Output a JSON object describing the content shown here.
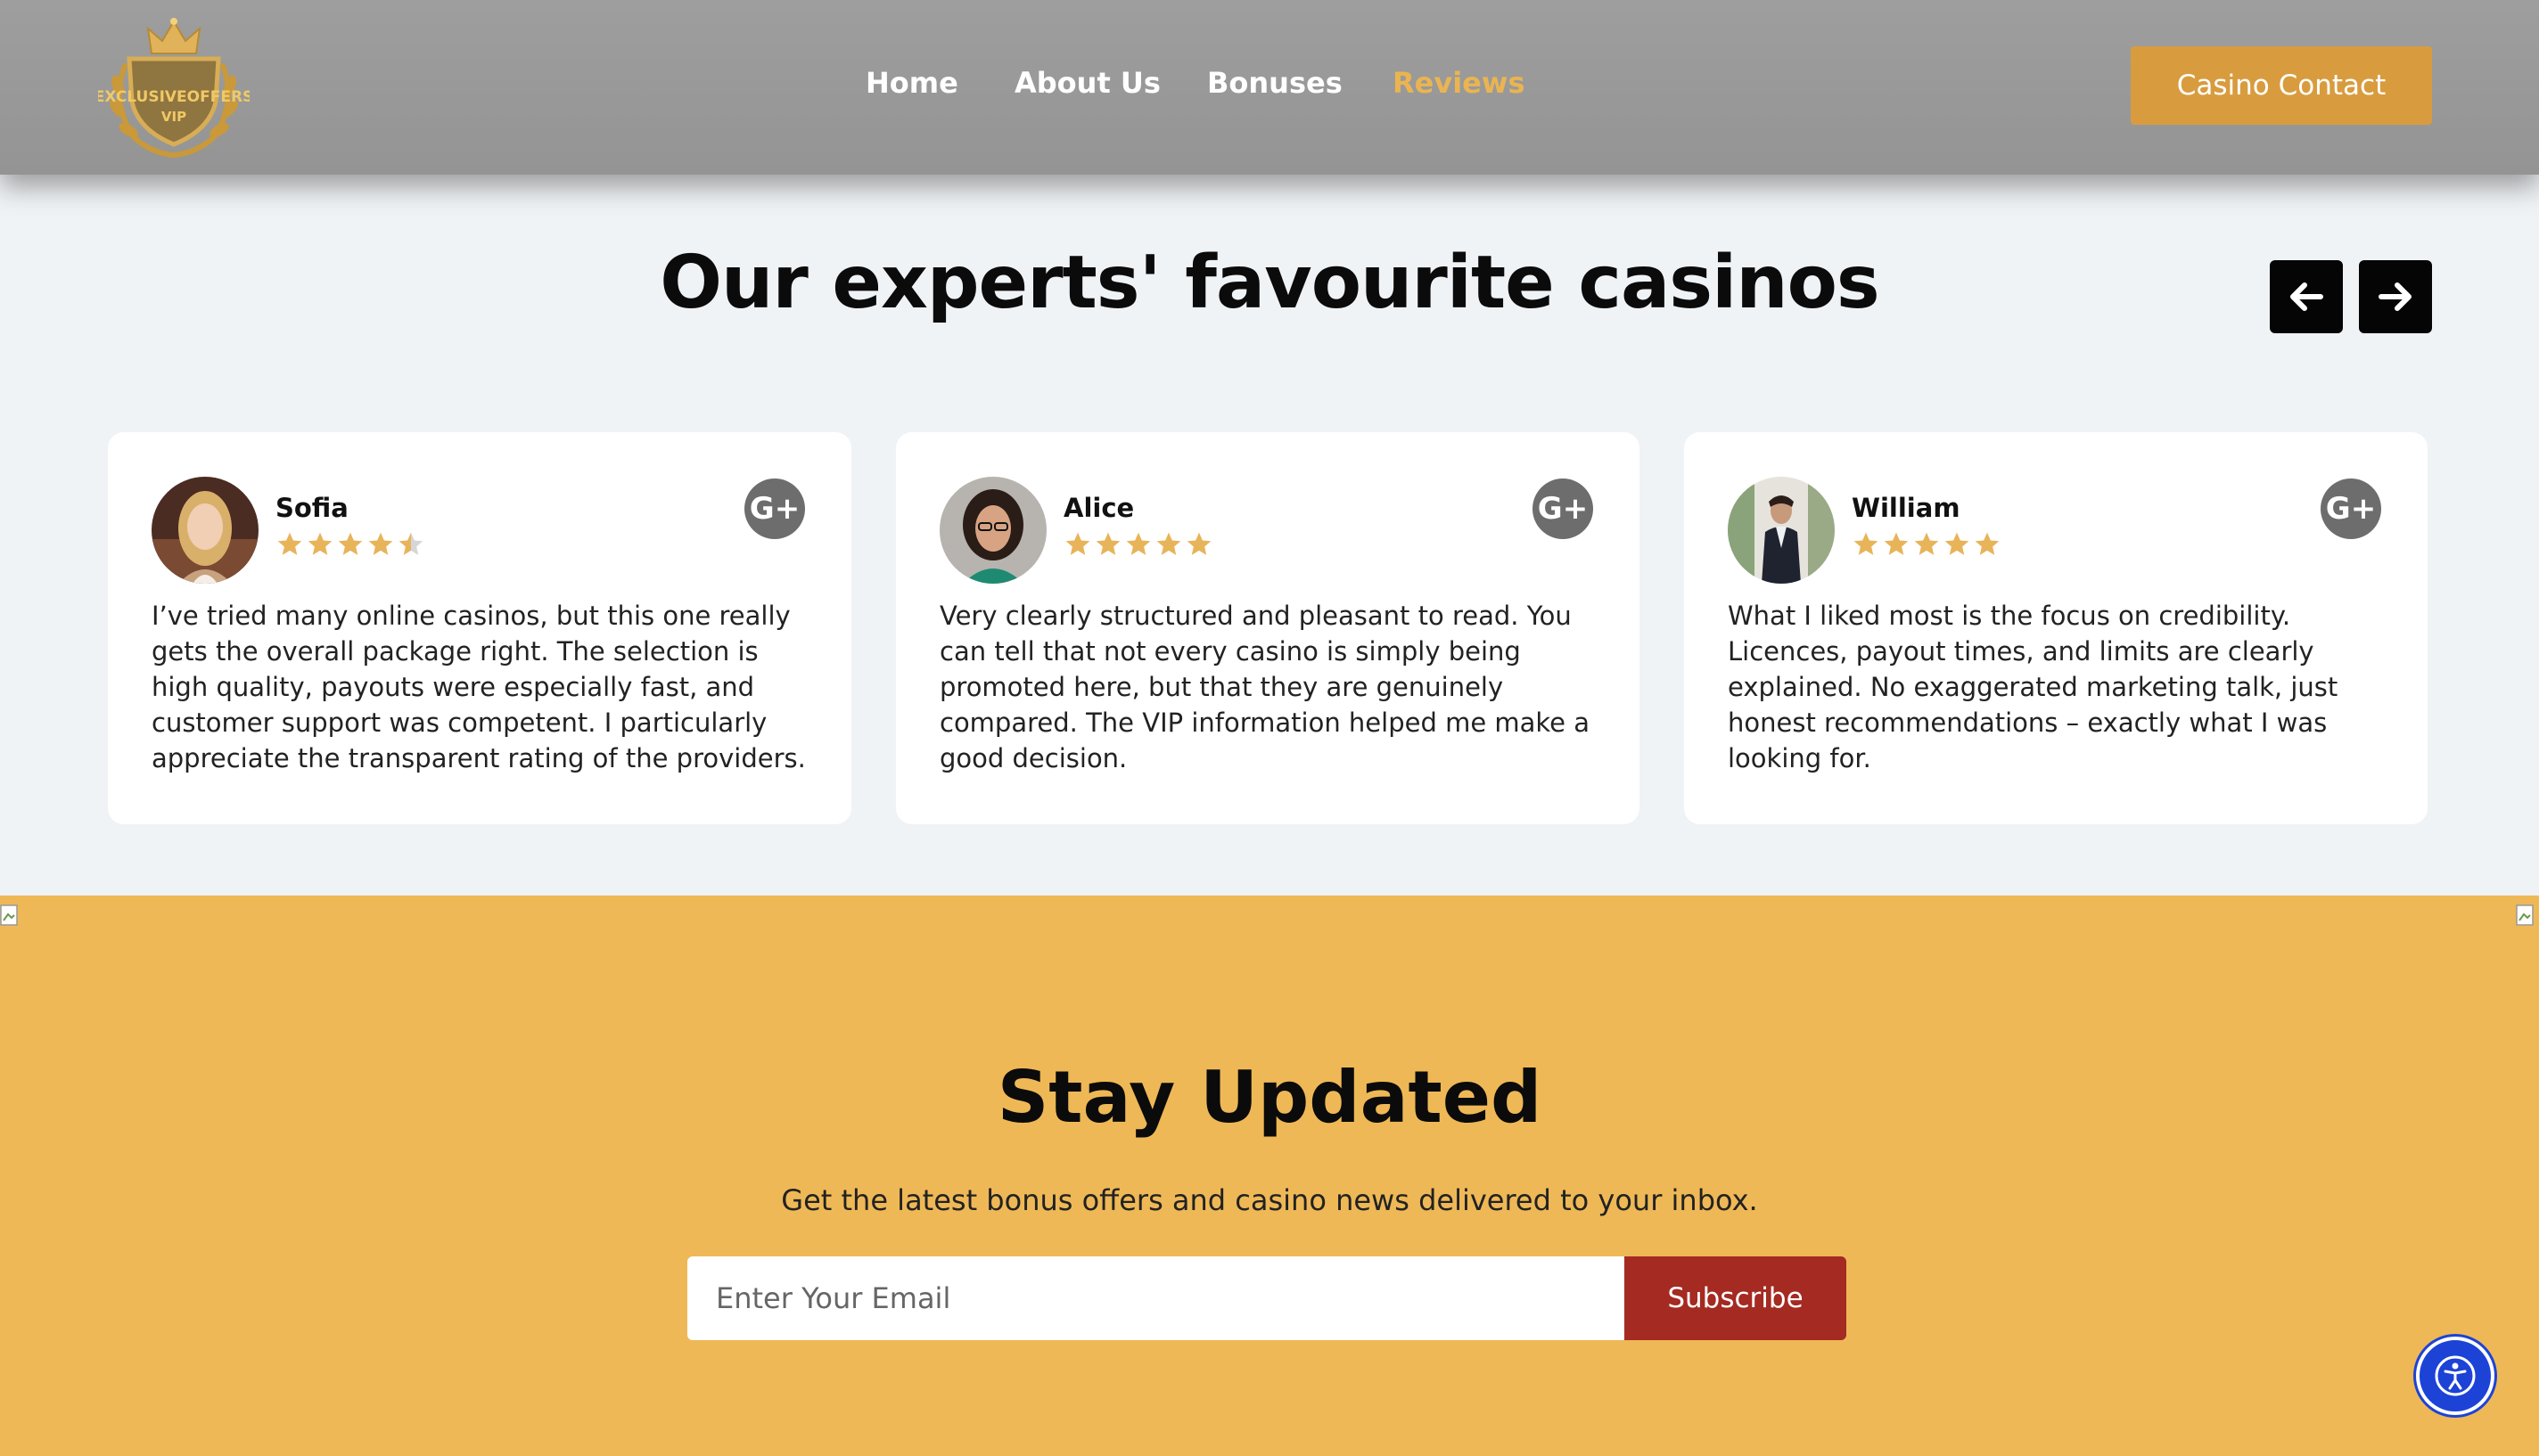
{
  "header": {
    "logo_text": "EXCLUSIVEOFFERS",
    "logo_subtext": "VIP",
    "nav": [
      {
        "label": "Home",
        "active": false
      },
      {
        "label": "About Us",
        "active": false
      },
      {
        "label": "Bonuses",
        "active": false
      },
      {
        "label": "Reviews",
        "active": true
      }
    ],
    "contact_button": "Casino Contact"
  },
  "reviews": {
    "title": "Our experts' favourite casinos",
    "prev_icon": "arrow-left-icon",
    "next_icon": "arrow-right-icon",
    "items": [
      {
        "name": "Sofia",
        "rating": 4.5,
        "text": "I’ve tried many online casinos, but this one really gets the overall package right. The selection is high quality, payouts were especially fast, and customer support was competent. I particularly appreciate the transparent rating of the providers.",
        "source_icon": "google-plus-icon"
      },
      {
        "name": "Alice",
        "rating": 5,
        "text": "Very clearly structured and pleasant to read. You can tell that not every casino is simply being promoted here, but that they are genuinely compared. The VIP information helped me make a good decision.",
        "source_icon": "google-plus-icon"
      },
      {
        "name": "William",
        "rating": 5,
        "text": "What I liked most is the focus on credibility. Licences, payout times, and limits are clearly explained. No exaggerated marketing talk, just honest recommendations – exactly what I was looking for.",
        "source_icon": "google-plus-icon"
      }
    ]
  },
  "newsletter": {
    "title": "Stay Updated",
    "subtitle": "Get the latest bonus offers and casino news delivered to your inbox.",
    "email_placeholder": "Enter Your Email",
    "subscribe_label": "Subscribe"
  },
  "colors": {
    "accent_gold": "#eab451",
    "button_gold": "#d89c3f",
    "newsletter_bg": "#efb856",
    "subscribe_red": "#a42a22",
    "star": "#e8b45a",
    "a11y_blue": "#1c43d6"
  }
}
